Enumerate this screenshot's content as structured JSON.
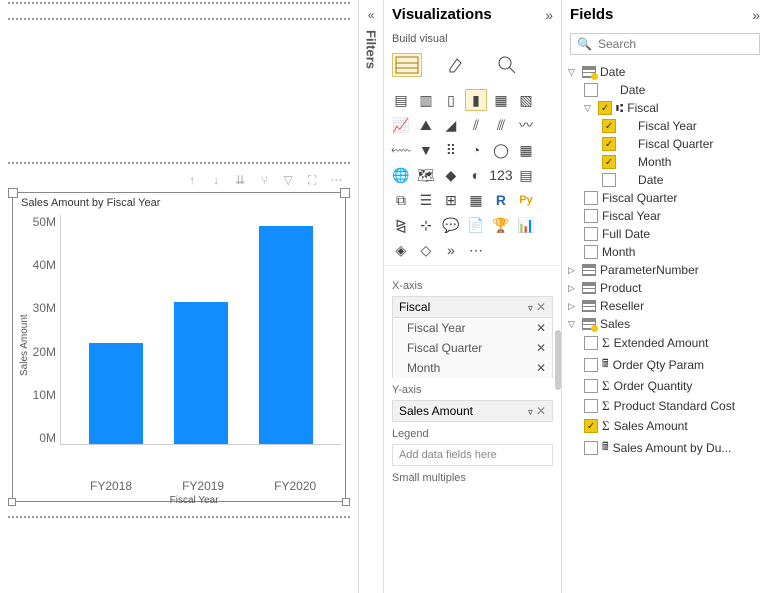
{
  "chart_data": {
    "type": "bar",
    "title": "Sales Amount by Fiscal Year",
    "xlabel": "Fiscal Year",
    "ylabel": "Sales Amount",
    "categories": [
      "FY2018",
      "FY2019",
      "FY2020"
    ],
    "values": [
      24000000,
      34000000,
      52000000
    ],
    "ylim": [
      0,
      55000000
    ],
    "yticks": [
      "50M",
      "40M",
      "30M",
      "20M",
      "10M",
      "0M"
    ]
  },
  "filters_label": "Filters",
  "viz": {
    "title": "Visualizations",
    "subtitle": "Build visual",
    "wells": {
      "x_label": "X-axis",
      "x_field": "Fiscal",
      "x_children": [
        "Fiscal Year",
        "Fiscal Quarter",
        "Month"
      ],
      "y_label": "Y-axis",
      "y_field": "Sales Amount",
      "legend_label": "Legend",
      "legend_placeholder": "Add data fields here",
      "sm_label": "Small multiples"
    }
  },
  "fields": {
    "title": "Fields",
    "search_placeholder": "Search",
    "tables": {
      "date": {
        "name": "Date",
        "children": [
          {
            "name": "Date",
            "checked": false
          },
          {
            "name": "Fiscal",
            "checked": true,
            "hierarchy": true,
            "children": [
              {
                "name": "Fiscal Year",
                "checked": true
              },
              {
                "name": "Fiscal Quarter",
                "checked": true
              },
              {
                "name": "Month",
                "checked": true
              },
              {
                "name": "Date",
                "checked": false
              }
            ]
          },
          {
            "name": "Fiscal Quarter",
            "checked": false
          },
          {
            "name": "Fiscal Year",
            "checked": false
          },
          {
            "name": "Full Date",
            "checked": false
          },
          {
            "name": "Month",
            "checked": false
          }
        ]
      },
      "param": "ParameterNumber",
      "product": "Product",
      "reseller": "Reseller",
      "sales": {
        "name": "Sales",
        "children": [
          {
            "name": "Extended Amount",
            "checked": false,
            "sigma": true
          },
          {
            "name": "Order Qty Param",
            "checked": false,
            "calc": true
          },
          {
            "name": "Order Quantity",
            "checked": false,
            "sigma": true
          },
          {
            "name": "Product Standard Cost",
            "checked": false,
            "sigma": true
          },
          {
            "name": "Sales Amount",
            "checked": true,
            "sigma": true
          },
          {
            "name": "Sales Amount by Du...",
            "checked": false,
            "calc": true
          }
        ]
      }
    }
  }
}
